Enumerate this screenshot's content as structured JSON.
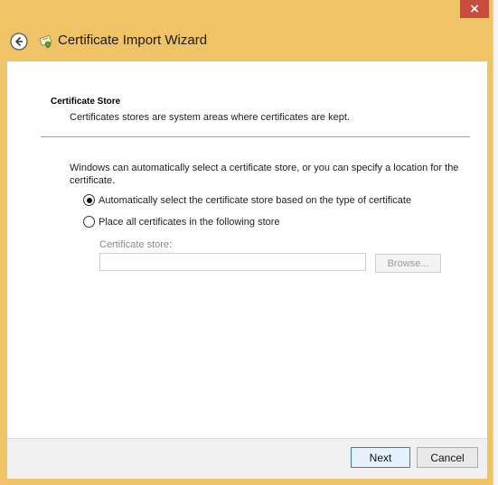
{
  "window": {
    "close_glyph": "×",
    "title": "Certificate Import Wizard",
    "back_icon": "back-arrow-icon",
    "title_icon": "certificate-icon"
  },
  "page": {
    "heading": "Certificate Store",
    "subheading": "Certificates stores are system areas where certificates are kept.",
    "description": "Windows can automatically select a certificate store, or you can specify a location for the certificate.",
    "options": [
      {
        "label": "Automatically select the certificate store based on the type of certificate",
        "checked": true
      },
      {
        "label": "Place all certificates in the following store",
        "checked": false
      }
    ],
    "store": {
      "label": "Certificate store:",
      "value": "",
      "browse_label": "Browse..."
    }
  },
  "footer": {
    "next_label": "Next",
    "cancel_label": "Cancel"
  },
  "colors": {
    "frame": "#f0c466",
    "close": "#c74c3c",
    "content_bg": "#ffffff",
    "footer_bg": "#f0f0f0",
    "next_border": "#3c7fb1"
  }
}
